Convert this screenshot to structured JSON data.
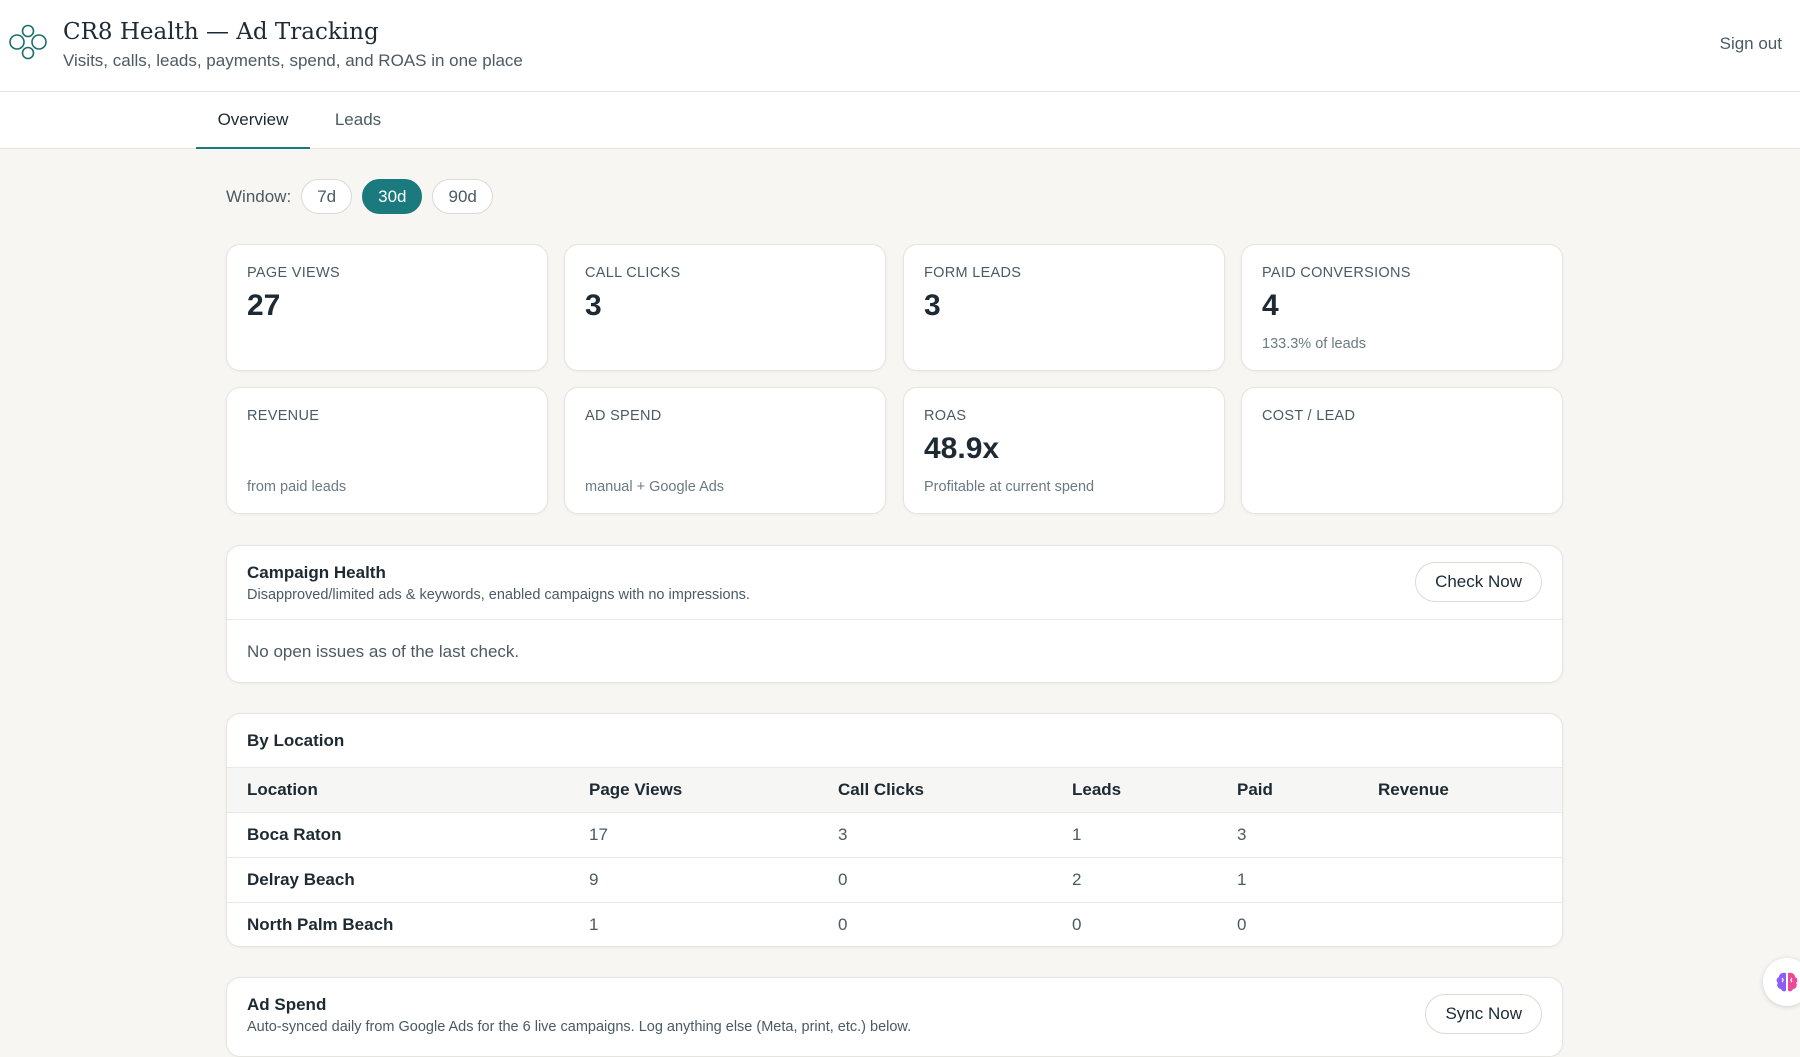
{
  "header": {
    "title": "CR8 Health — Ad Tracking",
    "subtitle": "Visits, calls, leads, payments, spend, and ROAS in one place",
    "signout_label": "Sign out"
  },
  "tabs": [
    {
      "label": "Overview",
      "active": true
    },
    {
      "label": "Leads",
      "active": false
    }
  ],
  "window": {
    "label": "Window:",
    "options": [
      "7d",
      "30d",
      "90d"
    ],
    "selected": "30d"
  },
  "metrics": [
    {
      "label": "PAGE VIEWS",
      "value": "27",
      "note": ""
    },
    {
      "label": "CALL CLICKS",
      "value": "3",
      "note": ""
    },
    {
      "label": "FORM LEADS",
      "value": "3",
      "note": ""
    },
    {
      "label": "PAID CONVERSIONS",
      "value": "4",
      "note": "133.3% of leads"
    },
    {
      "label": "REVENUE",
      "value": "",
      "note": "from paid leads"
    },
    {
      "label": "AD SPEND",
      "value": "",
      "note": "manual + Google Ads"
    },
    {
      "label": "ROAS",
      "value": "48.9x",
      "note": "Profitable at current spend"
    },
    {
      "label": "COST / LEAD",
      "value": "",
      "note": ""
    }
  ],
  "campaign_health": {
    "title": "Campaign Health",
    "description": "Disapproved/limited ads & keywords, enabled campaigns with no impressions.",
    "button_label": "Check Now",
    "status": "No open issues as of the last check."
  },
  "by_location": {
    "title": "By Location",
    "columns": [
      "Location",
      "Page Views",
      "Call Clicks",
      "Leads",
      "Paid",
      "Revenue"
    ],
    "rows": [
      [
        "Boca Raton",
        "17",
        "3",
        "1",
        "3",
        ""
      ],
      [
        "Delray Beach",
        "9",
        "0",
        "2",
        "1",
        ""
      ],
      [
        "North Palm Beach",
        "1",
        "0",
        "0",
        "0",
        ""
      ]
    ]
  },
  "ad_spend": {
    "title": "Ad Spend",
    "description": "Auto-synced daily from Google Ads for the 6 live campaigns. Log anything else (Meta, print, etc.) below.",
    "button_label": "Sync Now"
  },
  "colors": {
    "accent": "#1a7a7e",
    "background": "#f8f6f2",
    "text": "#1d2a33"
  }
}
